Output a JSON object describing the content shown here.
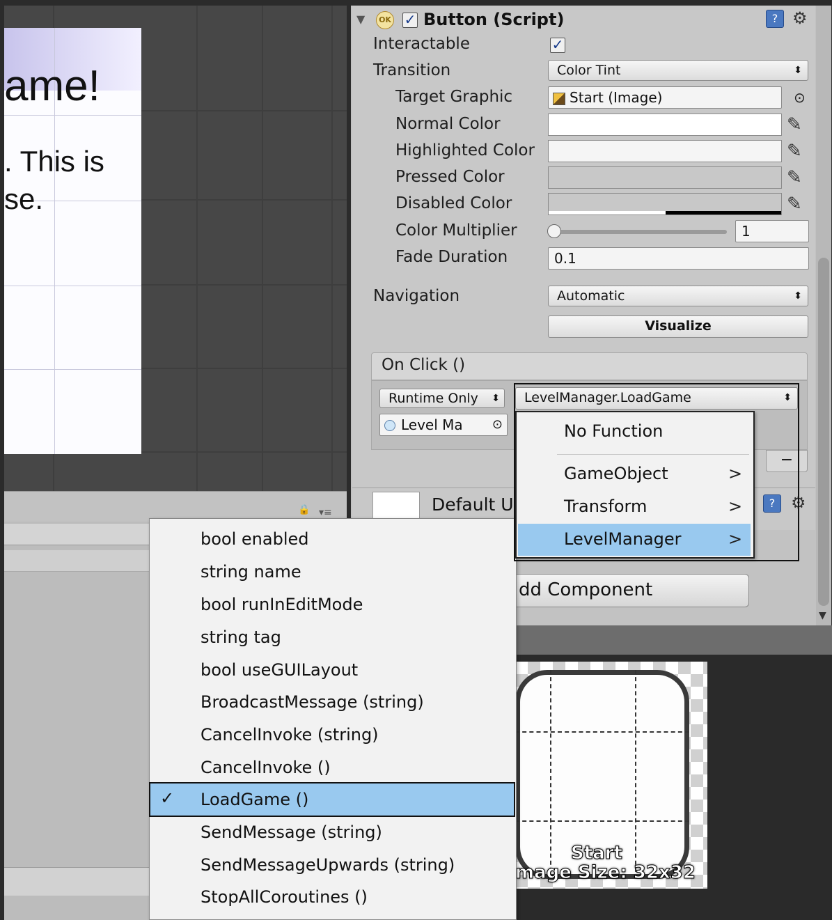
{
  "scene": {
    "title_text": "ame!",
    "line1": ". This is",
    "line2": "se."
  },
  "inspector": {
    "component_title": "Button (Script)",
    "ok_icon_text": "OK",
    "interactable_label": "Interactable",
    "interactable_checked": true,
    "transition_label": "Transition",
    "transition_value": "Color Tint",
    "target_graphic_label": "Target Graphic",
    "target_graphic_value": "Start (Image)",
    "normal_color_label": "Normal Color",
    "highlighted_color_label": "Highlighted Color",
    "pressed_color_label": "Pressed Color",
    "disabled_color_label": "Disabled Color",
    "color_multiplier_label": "Color Multiplier",
    "color_multiplier_value": "1",
    "fade_duration_label": "Fade Duration",
    "fade_duration_value": "0.1",
    "navigation_label": "Navigation",
    "navigation_value": "Automatic",
    "visualize_label": "Visualize",
    "onclick_label": "On Click ()",
    "runtime_value": "Runtime Only",
    "function_value": "LevelManager.LoadGame",
    "object_value": "Level Ma",
    "remove_label": "−",
    "default_label": "Default U",
    "add_component_label": "dd Component",
    "colors": {
      "normal": "#ffffff",
      "highlighted": "#f5f5f5",
      "pressed": "#c8c8c8",
      "disabled": "#c8c8c8",
      "accent": "#99c9ef"
    }
  },
  "function_menu": {
    "items": [
      {
        "label": "No Function",
        "submenu": false,
        "selected": false
      },
      {
        "label": "GameObject",
        "submenu": true,
        "selected": false
      },
      {
        "label": "Transform",
        "submenu": true,
        "selected": false
      },
      {
        "label": "LevelManager",
        "submenu": true,
        "selected": true
      }
    ],
    "chevron": ">"
  },
  "method_menu": {
    "items": [
      {
        "label": "bool enabled",
        "selected": false
      },
      {
        "label": "string name",
        "selected": false
      },
      {
        "label": "bool runInEditMode",
        "selected": false
      },
      {
        "label": "string tag",
        "selected": false
      },
      {
        "label": "bool useGUILayout",
        "selected": false
      },
      {
        "label": "BroadcastMessage (string)",
        "selected": false
      },
      {
        "label": "CancelInvoke (string)",
        "selected": false
      },
      {
        "label": "CancelInvoke ()",
        "selected": false
      },
      {
        "label": "LoadGame ()",
        "selected": true
      },
      {
        "label": "SendMessage (string)",
        "selected": false
      },
      {
        "label": "SendMessageUpwards (string)",
        "selected": false
      },
      {
        "label": "StopAllCoroutines ()",
        "selected": false
      }
    ],
    "check_glyph": "✓"
  },
  "preview": {
    "name": "Start",
    "size_text": "mage Size: 32x32"
  },
  "icons": {
    "foldout": "triangle-down-icon",
    "help": "help-book-icon",
    "gear": "gear-icon",
    "picker": "eyedropper-icon",
    "target": "object-picker-icon",
    "lock": "lock-icon"
  }
}
